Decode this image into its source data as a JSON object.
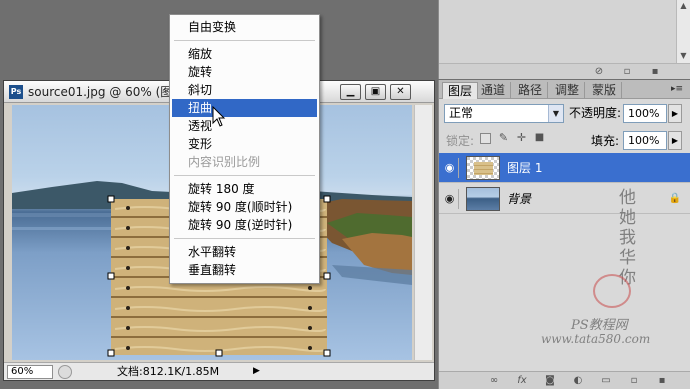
{
  "document": {
    "title": "source01.jpg @ 60% (图",
    "zoom": "60%",
    "doc_size": "文档:812.1K/1.85M"
  },
  "context_menu": {
    "items": [
      {
        "label": "自由变换"
      },
      {
        "label": "缩放"
      },
      {
        "label": "旋转"
      },
      {
        "label": "斜切"
      },
      {
        "label": "扭曲",
        "highlighted": true
      },
      {
        "label": "透视"
      },
      {
        "label": "变形"
      },
      {
        "label": "内容识别比例",
        "disabled": true
      },
      {
        "label": "旋转 180 度"
      },
      {
        "label": "旋转 90 度(顺时针)"
      },
      {
        "label": "旋转 90 度(逆时针)"
      },
      {
        "label": "水平翻转"
      },
      {
        "label": "垂直翻转"
      }
    ]
  },
  "layers_panel": {
    "tabs": [
      "图层",
      "通道",
      "路径",
      "调整",
      "蒙版"
    ],
    "blend_mode": "正常",
    "opacity_label": "不透明度:",
    "opacity_value": "100%",
    "lock_label": "锁定:",
    "fill_label": "填充:",
    "fill_value": "100%",
    "layers": [
      {
        "name": "图层 1",
        "selected": true
      },
      {
        "name": "背景",
        "locked": true
      }
    ]
  },
  "watermark": {
    "signature": "他她我华你",
    "site_line1": "PS教程网",
    "site_line2": "www.tata580.com"
  },
  "colors": {
    "menu_highlight": "#3168c6",
    "layer_selected": "#3a6fcf",
    "app_background": "#6f6f6f"
  }
}
